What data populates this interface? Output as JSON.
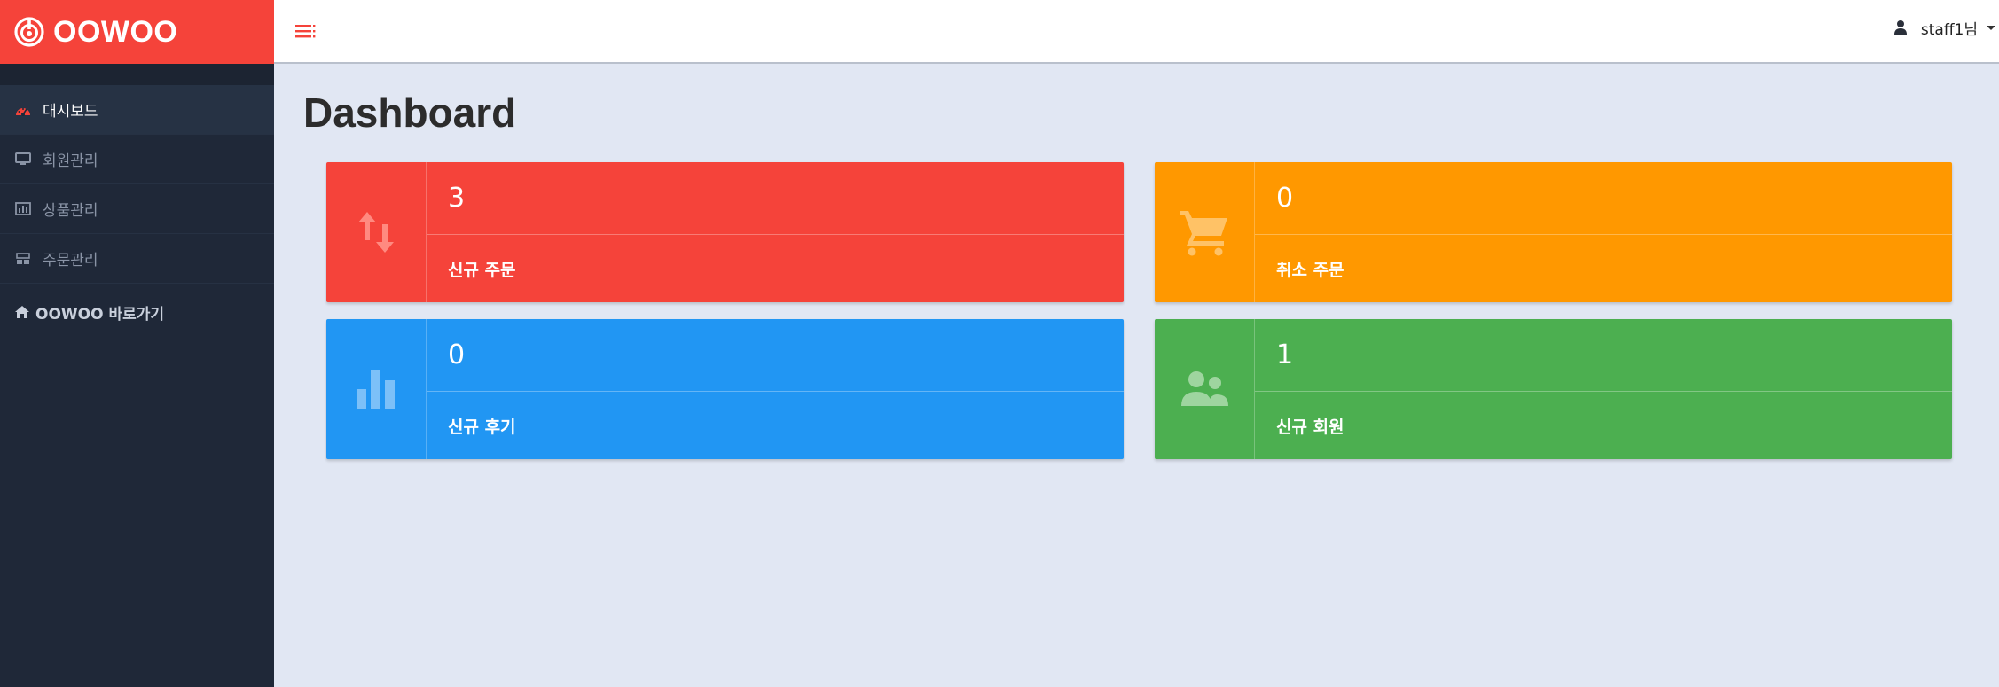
{
  "brand": {
    "name": "OOWOO",
    "logo_icon": "oowoo-logo-icon",
    "color": "#f5433a"
  },
  "sidebar": {
    "items": [
      {
        "label": "대시보드",
        "icon": "dashboard-gauge-icon",
        "active": true
      },
      {
        "label": "회원관리",
        "icon": "monitor-icon",
        "active": false
      },
      {
        "label": "상품관리",
        "icon": "bar-chart-icon",
        "active": false
      },
      {
        "label": "주문관리",
        "icon": "list-icon",
        "active": false
      }
    ],
    "home_link": {
      "label": "OOWOO 바로가기",
      "icon": "home-icon"
    }
  },
  "topbar": {
    "menu_icon": "hamburger-icon",
    "user": {
      "name": "staff1님",
      "icon": "user-icon"
    }
  },
  "main": {
    "title": "Dashboard",
    "cards": [
      {
        "value": "3",
        "label": "신규 주문",
        "icon": "arrows-up-down-icon",
        "color": "#f5433a"
      },
      {
        "value": "0",
        "label": "취소 주문",
        "icon": "shopping-cart-icon",
        "color": "#ff9800"
      },
      {
        "value": "0",
        "label": "신규 후기",
        "icon": "bar-chart-icon",
        "color": "#2196f3"
      },
      {
        "value": "1",
        "label": "신규 회원",
        "icon": "users-icon",
        "color": "#4caf50"
      }
    ]
  }
}
